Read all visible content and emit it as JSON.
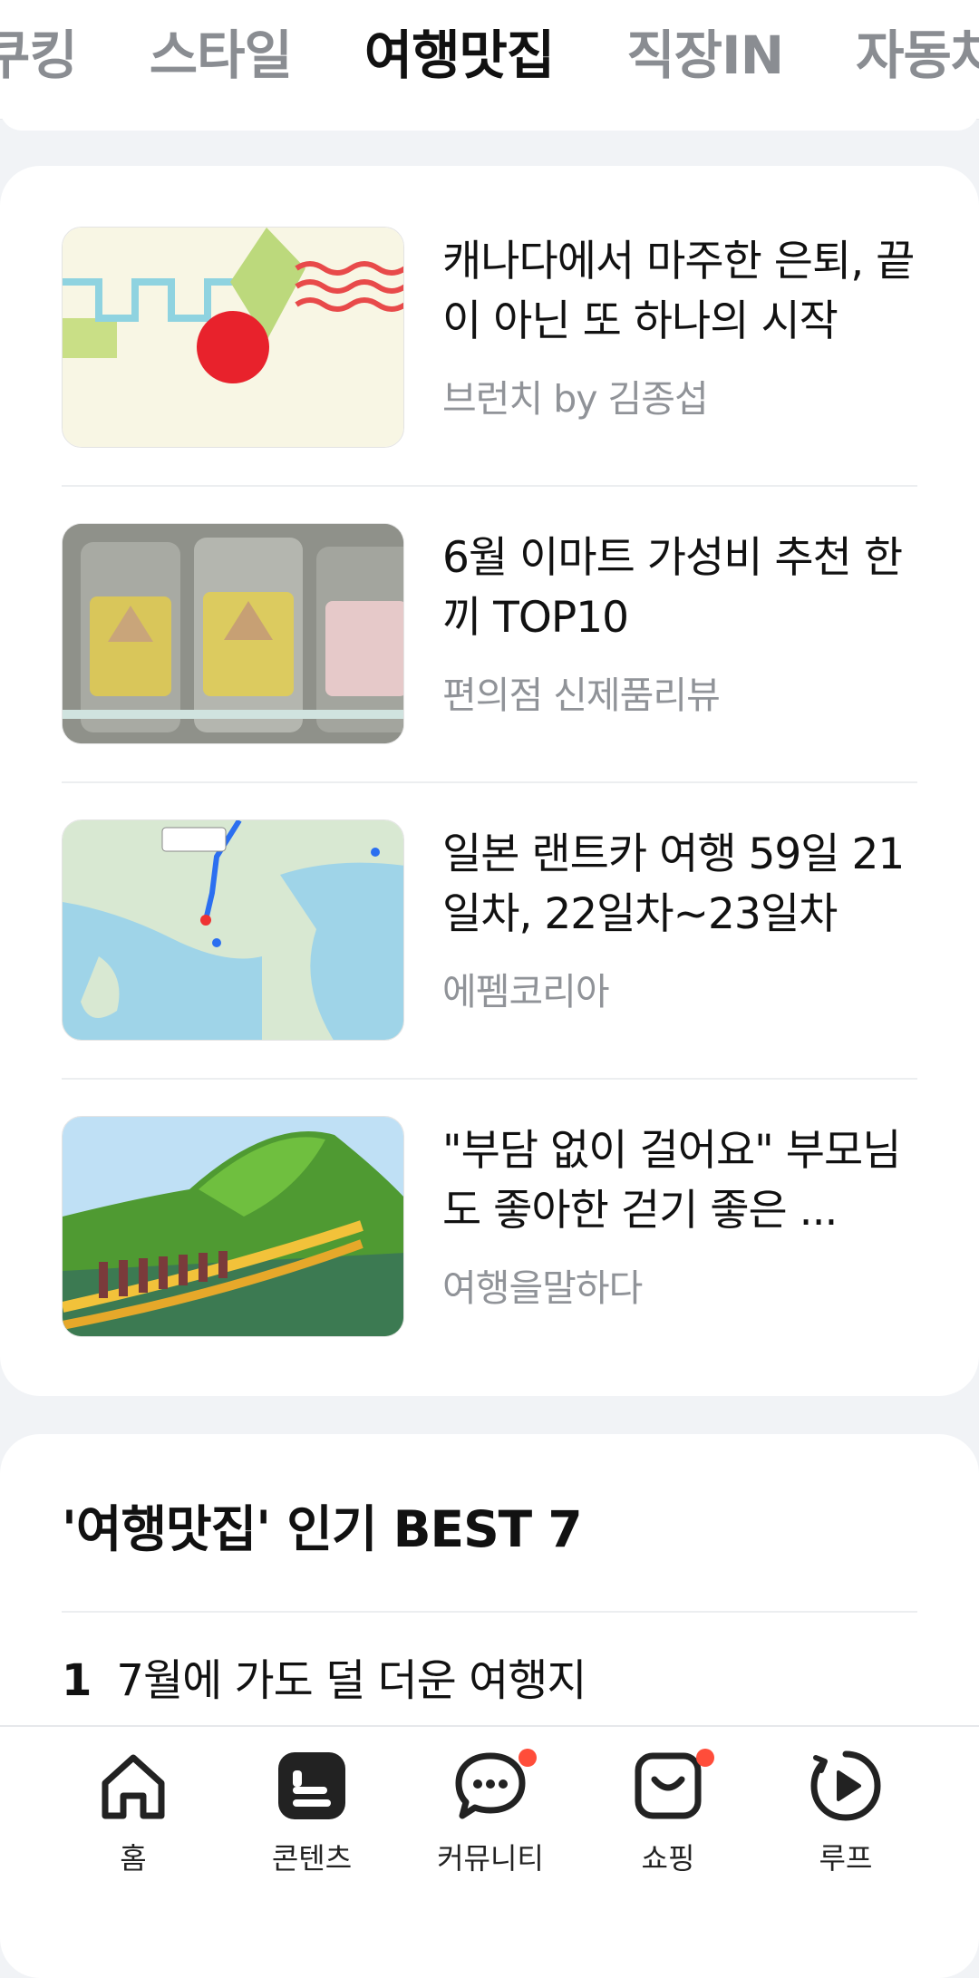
{
  "tabs": [
    {
      "label": "쿠킹"
    },
    {
      "label": "스타일"
    },
    {
      "label": "여행맛집"
    },
    {
      "label": "직장IN"
    },
    {
      "label": "자동차"
    }
  ],
  "active_tab": "여행맛집",
  "articles": [
    {
      "title": "캐나다에서 마주한 은퇴, 끝이 아닌 또 하나의 시작",
      "source": "브런치 by 김종섭",
      "thumb_icon": "abstract-art-thumbnail"
    },
    {
      "title": "6월 이마트 가성비 추천 한끼 TOP10",
      "source": "편의점 신제품리뷰",
      "thumb_icon": "triangle-kimbap-thumbnail"
    },
    {
      "title": "일본 랜트카 여행 59일 21일차, 22일차~23일차",
      "source": "에펨코리아",
      "thumb_icon": "map-route-thumbnail"
    },
    {
      "title": "\"부담 없이 걸어요\" 부모님도 좋아한 걷기 좋은 ...",
      "source": "여행을말하다",
      "thumb_icon": "suspension-bridge-thumbnail"
    }
  ],
  "best": {
    "title": "'여행맛집' 인기 BEST 7",
    "items": [
      {
        "rank": "1",
        "text": "7월에 가도 덜 더운 여행지"
      }
    ]
  },
  "bottom_nav": [
    {
      "label": "홈",
      "icon": "home-icon",
      "dot": false
    },
    {
      "label": "콘텐츠",
      "icon": "contents-icon",
      "dot": false
    },
    {
      "label": "커뮤니티",
      "icon": "chat-bubble-icon",
      "dot": true
    },
    {
      "label": "쇼핑",
      "icon": "shopping-bag-icon",
      "dot": true
    },
    {
      "label": "루프",
      "icon": "play-loop-icon",
      "dot": false
    }
  ],
  "colors": {
    "accent_dot": "#ff4d3a",
    "active_tab": "#111111",
    "inactive_tab": "#8a8d92"
  }
}
